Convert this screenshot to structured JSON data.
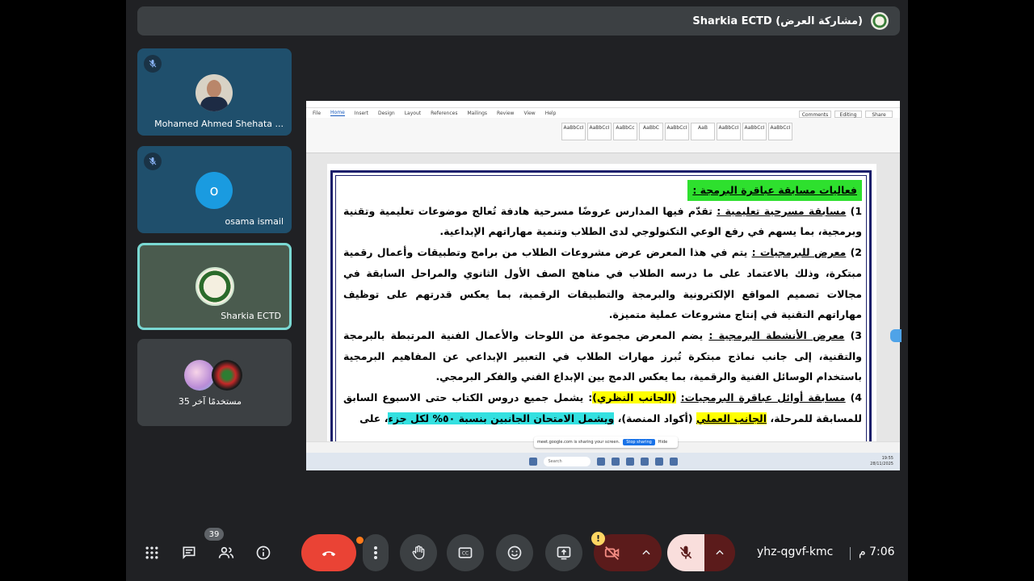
{
  "presenter": {
    "label": "Sharkia ECTD (مشاركة العرض)"
  },
  "participants": [
    {
      "name": "Mohamed Ahmed Shehata ...",
      "muted": true,
      "avatar": "photo"
    },
    {
      "name": "osama ismail",
      "muted": true,
      "avatar": "letter",
      "initial": "o"
    },
    {
      "name": "Sharkia ECTD",
      "muted": false,
      "avatar": "logo"
    },
    {
      "name": "35 مستخدمًا آخر",
      "muted": false,
      "avatar": "group"
    }
  ],
  "ribbon": {
    "tabs": [
      "File",
      "Home",
      "Insert",
      "Design",
      "Layout",
      "References",
      "Mailings",
      "Review",
      "View",
      "Help"
    ],
    "active_tab": "Home",
    "styles": [
      "AaBbCcI",
      "AaBbCcI",
      "AaBbCc",
      "AaBbC",
      "AaBbCcI",
      "AaB",
      "AaBbCcI",
      "AaBbCcI",
      "AaBbCcI"
    ],
    "buttons": [
      "Comments",
      "Editing",
      "Share"
    ]
  },
  "document": {
    "heading": "فعاليات مسابقة عباقرة البرمجة :",
    "items": [
      {
        "num": "1)",
        "title": "مسابقة مسرحية تعليمية :",
        "text": " تقدّم فيها المدارس عروضًا مسرحية هادفة تُعالج موضوعات تعليمية وتقنية وبرمجية، بما يسهم في رفع الوعي التكنولوجي لدى الطلاب وتنمية مهاراتهم الإبداعية."
      },
      {
        "num": "2)",
        "title": "معرض للبرمجيات :",
        "text": " يتم في هذا المعرض عرض مشروعات الطلاب من برامج وتطبيقات وأعمال رقمية مبتكرة، وذلك بالاعتماد على ما درسه الطلاب في مناهج الصف الأول الثانوي والمراحل السابقة في مجالات تصميم المواقع الإلكترونية والبرمجة والتطبيقات الرقمية، بما يعكس قدرتهم على توظيف مهاراتهم التقنية في إنتاج مشروعات عملية متميزة."
      },
      {
        "num": "3)",
        "title": "معرض الأنشطة البرمجية :",
        "text": " يضم المعرض مجموعة من اللوحات والأعمال الفنية المرتبطة بالبرمجة والتقنية، إلى جانب نماذج مبتكرة تُبرز مهارات الطلاب في التعبير الإبداعي عن المفاهيم البرمجية باستخدام الوسائل الفنية والرقمية، بما يعكس الدمج بين الإبداع الفني والفكر البرمجي."
      },
      {
        "num": "4)",
        "title": "مسابقة أوائل عباقرة البرمجيات:",
        "p1": " ",
        "theory": "(الجانب النظري)",
        "p2": ": يشمل جميع دروس الكتاب حتى الاسبوع السابق للمسابقة للمرحلة، ",
        "practical": "الجانب العملي",
        "p3": " (أكواد المنصة)، ",
        "exam": "ويشمل الامتحان الجانبين بنسبة ٥٠% لكل جزء",
        "p4": "، على"
      }
    ]
  },
  "share_notice": {
    "text": "meet.google.com is sharing your screen.",
    "stop": "Stop sharing",
    "hide": "Hide"
  },
  "taskbar": {
    "search": "Search",
    "time": "19:55",
    "date": "28/11/2025"
  },
  "controls": {
    "participants_count": "39",
    "meeting_code": "yhz-qgvf-kmc",
    "time": "7:06 م",
    "warning": "!"
  },
  "colors": {
    "end_call": "#ea4335",
    "accent": "#7ad9d3",
    "highlight_green": "#2ee02e",
    "highlight_yellow": "#ffff00",
    "highlight_cyan": "#33e0e0"
  }
}
